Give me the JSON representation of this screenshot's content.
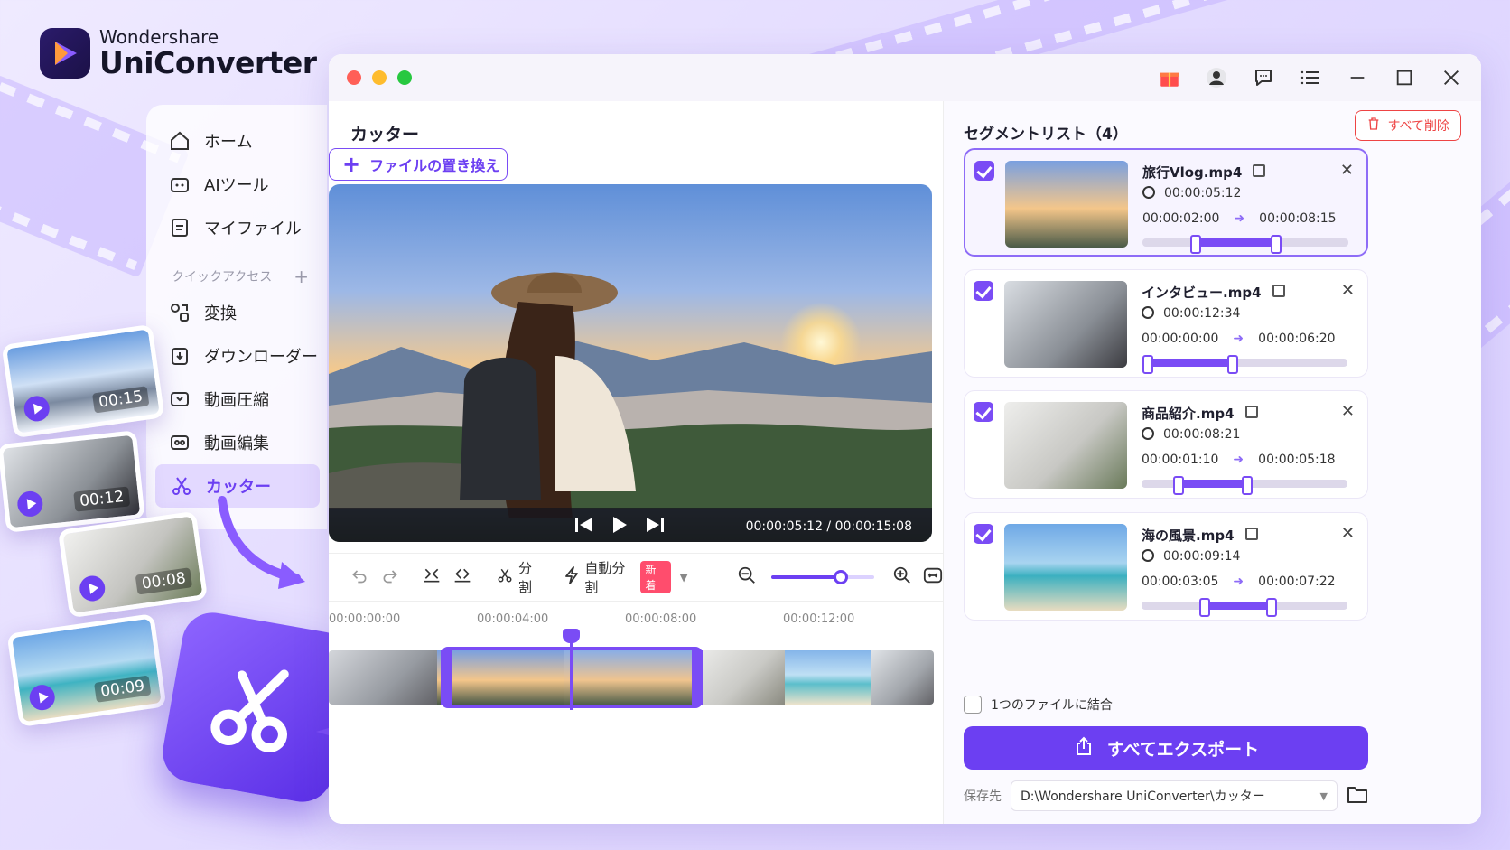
{
  "logo": {
    "line1": "Wondershare",
    "line2": "UniConverter"
  },
  "sidebar": {
    "items": [
      {
        "label": "ホーム",
        "icon": "home-icon"
      },
      {
        "label": "AIツール",
        "icon": "ai-tools-icon"
      },
      {
        "label": "マイファイル",
        "icon": "my-files-icon"
      }
    ],
    "quick_access_label": "クイックアクセス",
    "quick_items": [
      {
        "label": "変換",
        "icon": "convert-icon"
      },
      {
        "label": "ダウンローダー",
        "icon": "downloader-icon"
      },
      {
        "label": "動画圧縮",
        "icon": "compress-icon"
      },
      {
        "label": "動画編集",
        "icon": "edit-video-icon"
      },
      {
        "label": "カッター",
        "icon": "scissors-icon",
        "active": true
      }
    ]
  },
  "floating_thumbs": [
    {
      "duration": "00:15"
    },
    {
      "duration": "00:12"
    },
    {
      "duration": "00:08"
    },
    {
      "duration": "00:09"
    }
  ],
  "editor": {
    "title": "カッター",
    "replace_label": "ファイルの置き換え",
    "time_display": "00:00:05:12 / 00:00:15:08",
    "toolbar": {
      "split": "分割",
      "auto_split": "自動分割",
      "new_badge": "新着"
    },
    "ruler": [
      "00:00:00:00",
      "00:00:04:00",
      "00:00:08:00",
      "00:00:12:00"
    ],
    "zoom": 0.68
  },
  "segments": {
    "title": "セグメントリスト（4）",
    "delete_all": "すべて削除",
    "items": [
      {
        "name": "旅行Vlog.mp4",
        "duration": "00:00:05:12",
        "start": "00:00:02:00",
        "end": "00:00:08:15",
        "range": [
          0.25,
          0.66
        ],
        "selected": true,
        "thumb": "linear-gradient(180deg,#7aa0e0,#f4c68a 55%,#4a5a48)"
      },
      {
        "name": "インタビュー.mp4",
        "duration": "00:00:12:34",
        "start": "00:00:00:00",
        "end": "00:00:06:20",
        "range": [
          0.02,
          0.45
        ],
        "selected": false,
        "thumb": "linear-gradient(135deg,#d9dde2,#8a8f96 60%,#3b3b40)"
      },
      {
        "name": "商品紹介.mp4",
        "duration": "00:00:08:21",
        "start": "00:00:01:10",
        "end": "00:00:05:18",
        "range": [
          0.17,
          0.52
        ],
        "selected": false,
        "thumb": "linear-gradient(135deg,#eeeeec,#c8c8c4 55%,#6a7a5a)"
      },
      {
        "name": "海の風景.mp4",
        "duration": "00:00:09:14",
        "start": "00:00:03:05",
        "end": "00:00:07:22",
        "range": [
          0.3,
          0.64
        ],
        "selected": false,
        "thumb": "linear-gradient(180deg,#6fa8e6,#a8d4f0 45%,#3bb0c0 60%,#e8dcc0)"
      }
    ]
  },
  "merge_label": "1つのファイルに結合",
  "export_label": "すべてエクスポート",
  "save": {
    "label": "保存先",
    "path": "D:\\Wondershare UniConverter\\カッター"
  },
  "colors": {
    "accent": "#6c3ff2",
    "danger": "#e44444"
  }
}
